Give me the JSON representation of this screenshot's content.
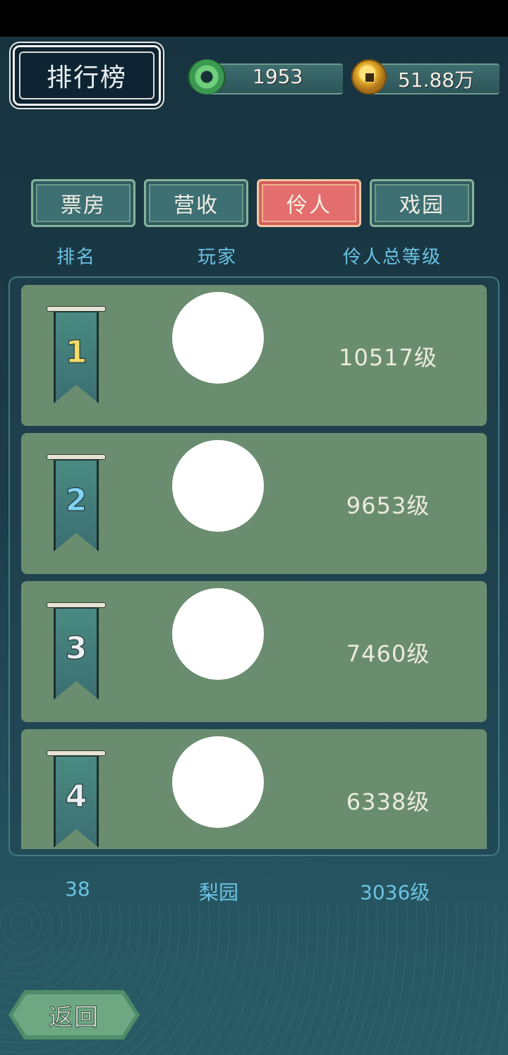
{
  "header": {
    "title": "排行榜",
    "currencies": [
      {
        "icon": "jade-ring-icon",
        "value": "1953"
      },
      {
        "icon": "copper-coin-icon",
        "value": "51.88万"
      }
    ]
  },
  "tabs": [
    {
      "label": "票房",
      "active": false
    },
    {
      "label": "营收",
      "active": false
    },
    {
      "label": "伶人",
      "active": true
    },
    {
      "label": "戏园",
      "active": false
    }
  ],
  "columns": {
    "rank": "排名",
    "player": "玩家",
    "level": "伶人总等级"
  },
  "rows": [
    {
      "rank": "1",
      "level": "10517级"
    },
    {
      "rank": "2",
      "level": "9653级"
    },
    {
      "rank": "3",
      "level": "7460级"
    },
    {
      "rank": "4",
      "level": "6338级"
    }
  ],
  "self": {
    "rank": "38",
    "player": "梨园",
    "level": "3036级"
  },
  "back_button": {
    "label": "返回"
  },
  "colors": {
    "accent_active_tab": "#e46e6e",
    "row_bg": "#6a8d6f",
    "header_text": "#6cc3e3"
  }
}
